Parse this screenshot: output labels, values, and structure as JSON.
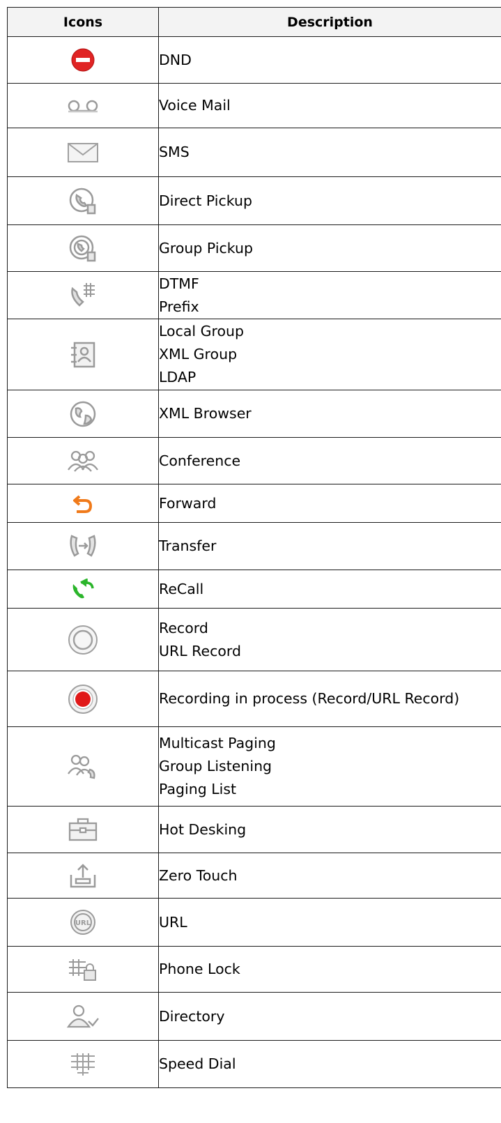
{
  "table": {
    "headers": {
      "icons": "Icons",
      "description": "Description"
    },
    "rows": [
      {
        "icon": "dnd-icon",
        "lines": [
          "DND"
        ]
      },
      {
        "icon": "voicemail-icon",
        "lines": [
          "Voice Mail"
        ]
      },
      {
        "icon": "sms-envelope-icon",
        "lines": [
          "SMS"
        ]
      },
      {
        "icon": "direct-pickup-icon",
        "lines": [
          "Direct Pickup"
        ]
      },
      {
        "icon": "group-pickup-icon",
        "lines": [
          "Group Pickup"
        ]
      },
      {
        "icon": "dtmf-keypad-icon",
        "lines": [
          "DTMF",
          "Prefix"
        ]
      },
      {
        "icon": "contact-book-icon",
        "lines": [
          "Local Group",
          "XML Group",
          "LDAP"
        ]
      },
      {
        "icon": "globe-icon",
        "lines": [
          "XML Browser"
        ]
      },
      {
        "icon": "conference-icon",
        "lines": [
          "Conference"
        ]
      },
      {
        "icon": "forward-arrow-icon",
        "lines": [
          "Forward"
        ]
      },
      {
        "icon": "transfer-icon",
        "lines": [
          "Transfer"
        ]
      },
      {
        "icon": "recall-icon",
        "lines": [
          "ReCall"
        ]
      },
      {
        "icon": "record-icon",
        "lines": [
          "Record",
          "URL Record"
        ]
      },
      {
        "icon": "recording-in-process-icon",
        "lines": [
          "Recording in process (Record/URL Record)"
        ]
      },
      {
        "icon": "paging-icon",
        "lines": [
          "Multicast Paging",
          "Group Listening",
          "Paging List"
        ]
      },
      {
        "icon": "hot-desking-briefcase-icon",
        "lines": [
          "Hot Desking"
        ]
      },
      {
        "icon": "zero-touch-upload-icon",
        "lines": [
          "Zero Touch"
        ]
      },
      {
        "icon": "url-icon",
        "lines": [
          "URL"
        ]
      },
      {
        "icon": "phone-lock-icon",
        "lines": [
          "Phone Lock"
        ]
      },
      {
        "icon": "directory-icon",
        "lines": [
          "Directory"
        ]
      },
      {
        "icon": "speed-dial-icon",
        "lines": [
          "Speed Dial"
        ]
      }
    ],
    "colors": {
      "dnd": "#e02424",
      "forward": "#f07a1a",
      "recall": "#2bb52b",
      "recording": "#e01818",
      "icon_gray": "#9a9a9a"
    }
  }
}
